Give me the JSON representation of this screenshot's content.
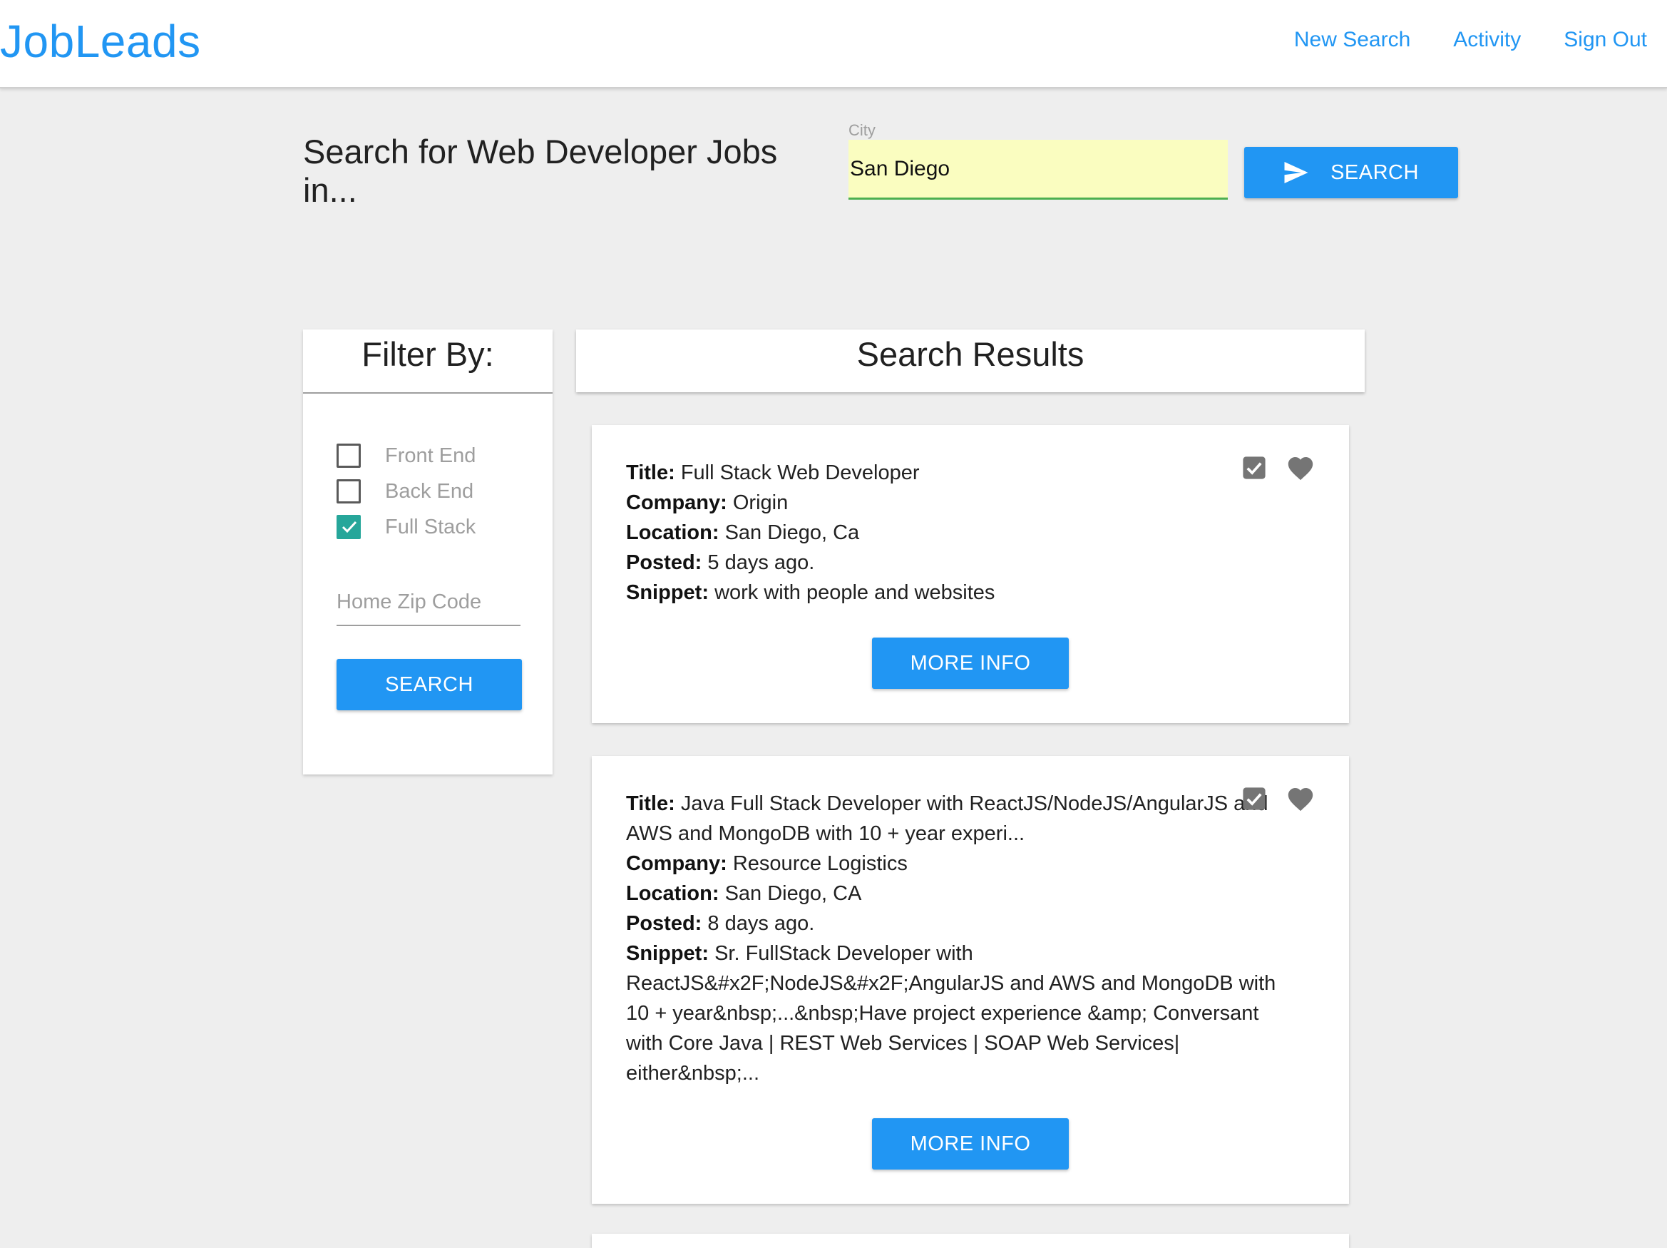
{
  "header": {
    "brand": "JobLeads",
    "nav": [
      "New Search",
      "Activity",
      "Sign Out"
    ]
  },
  "search": {
    "heading": "Search for Web Developer Jobs in...",
    "city_label": "City",
    "city_value": "San Diego",
    "button_label": "SEARCH"
  },
  "filter": {
    "title": "Filter By:",
    "options": [
      {
        "label": "Front End",
        "checked": false
      },
      {
        "label": "Back End",
        "checked": false
      },
      {
        "label": "Full Stack",
        "checked": true
      }
    ],
    "zip_placeholder": "Home Zip Code",
    "button_label": "SEARCH"
  },
  "results": {
    "title": "Search Results",
    "jobs": [
      {
        "title_label": "Title:",
        "title": "Full Stack Web Developer",
        "company_label": "Company:",
        "company": "Origin",
        "location_label": "Location:",
        "location": "San Diego, Ca",
        "posted_label": "Posted:",
        "posted": "5 days ago.",
        "snippet_label": "Snippet:",
        "snippet": "work with people and websites",
        "button_label": "MORE INFO"
      },
      {
        "title_label": "Title:",
        "title": "Java Full Stack Developer with ReactJS/NodeJS/AngularJS and AWS and MongoDB with 10 + year experi...",
        "company_label": "Company:",
        "company": "Resource Logistics",
        "location_label": "Location:",
        "location": "San Diego, CA",
        "posted_label": "Posted:",
        "posted": "8 days ago.",
        "snippet_label": "Snippet:",
        "snippet": "Sr. FullStack Developer with ReactJS&#x2F;NodeJS&#x2F;AngularJS and AWS and MongoDB with 10 + year&nbsp;...&nbsp;Have project experience &amp; Conversant with Core Java | REST Web Services | SOAP Web Services| either&nbsp;...",
        "button_label": "MORE INFO"
      }
    ]
  },
  "colors": {
    "accent": "#2196f3",
    "checkbox_checked": "#26a69a",
    "input_highlight": "#fafdc0",
    "input_underline_active": "#4caf50",
    "icon_gray": "#757575"
  }
}
